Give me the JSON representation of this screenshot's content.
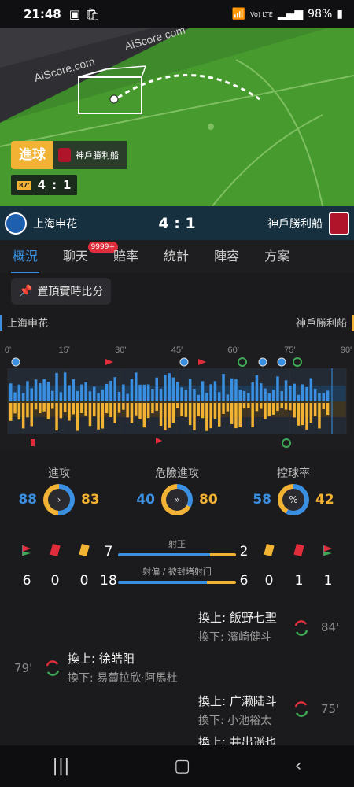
{
  "status": {
    "time": "21:48",
    "battery": "98%",
    "network": "Vo) LTE"
  },
  "pitch": {
    "watermark": "AiScore.com",
    "goal_label": "進球",
    "goal_team": "神戶勝利船",
    "minute": "87'",
    "home_score": "4",
    "away_score": "1",
    "sep": ":"
  },
  "match": {
    "home": "上海申花",
    "away": "神戶勝利船",
    "score": "4 : 1"
  },
  "tabs": [
    {
      "label": "概況"
    },
    {
      "label": "聊天",
      "badge": "9999+"
    },
    {
      "label": "賠率"
    },
    {
      "label": "統計"
    },
    {
      "label": "陣容"
    },
    {
      "label": "方案"
    }
  ],
  "pin_button": "置頂實時比分",
  "teams_row": {
    "home": "上海申花",
    "away": "神戶勝利船"
  },
  "timeline": {
    "ticks": [
      "0'",
      "15'",
      "30'",
      "45'",
      "60'",
      "75'",
      "90'"
    ]
  },
  "stats": {
    "attack": {
      "label": "進攻",
      "home": "88",
      "away": "83",
      "home_frac": 0.51
    },
    "danger": {
      "label": "危險進攻",
      "home": "40",
      "away": "80",
      "home_frac": 0.33
    },
    "possession": {
      "label": "控球率",
      "home": "58",
      "away": "42",
      "home_frac": 0.58,
      "icon": "%"
    },
    "shots_on": {
      "label": "射正",
      "home": "7",
      "away": "2"
    },
    "shots_off": {
      "label": "射偏 / 被封堵射门",
      "home": "18",
      "away": "6"
    },
    "home_corners": "6",
    "home_red": "0",
    "home_yellow": "0",
    "away_yellow": "0",
    "away_red": "1",
    "away_corners": "1"
  },
  "events": [
    {
      "side": "away",
      "in": "換上: 飯野七聖",
      "out": "換下: 濱崎健斗",
      "minute": "84'"
    },
    {
      "side": "home",
      "in": "換上: 徐皓阳",
      "out": "換下: 易蔔拉欣·阿馬杜",
      "minute": "79'"
    },
    {
      "side": "away",
      "in": "換上: 广濑陆斗",
      "out": "換下: 小池裕太",
      "minute": "75'"
    },
    {
      "side": "away",
      "in": "換上: 井出遥也",
      "out": "",
      "minute": ""
    }
  ],
  "colors": {
    "home": "#3b8fe0",
    "away": "#f2b233",
    "pitch": "#3f8a2a",
    "accent_tab": "#3b8fe0"
  }
}
